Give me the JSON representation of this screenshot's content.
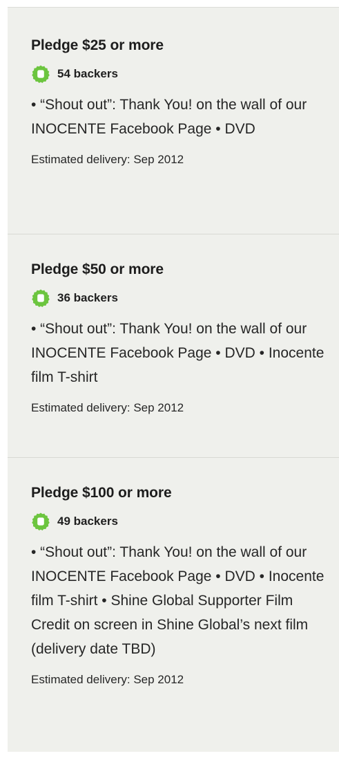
{
  "colors": {
    "panel_background": "#eff0ec",
    "badge_green": "#6cc53f",
    "text": "#1f1f1f",
    "divider": "#d8d9d3"
  },
  "tiers": [
    {
      "title": "Pledge $25 or more",
      "backers": "54 backers",
      "badge_icon": "backer-badge-icon",
      "description": "• “Shout out”: Thank You! on the wall of our INOCENTE Facebook Page • DVD",
      "delivery": "Estimated delivery: Sep 2012"
    },
    {
      "title": "Pledge $50 or more",
      "backers": "36 backers",
      "badge_icon": "backer-badge-icon",
      "description": "• “Shout out”: Thank You! on the wall of our INOCENTE Facebook Page • DVD • Inocente film T-shirt",
      "delivery": "Estimated delivery: Sep 2012"
    },
    {
      "title": "Pledge $100 or more",
      "backers": "49 backers",
      "badge_icon": "backer-badge-icon",
      "description": "• “Shout out”: Thank You! on the wall of our INOCENTE Facebook Page • DVD • Inocente film T-shirt • Shine Global Supporter Film Credit on screen in Shine Global’s next film (delivery date TBD)",
      "delivery": "Estimated delivery: Sep 2012"
    }
  ]
}
